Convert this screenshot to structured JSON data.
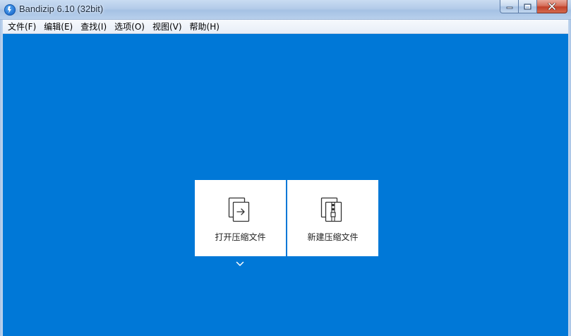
{
  "window": {
    "title": "Bandizip 6.10 (32bit)",
    "icon": "bandizip-app-icon",
    "controls": {
      "minimize_icon": "minimize-icon",
      "maximize_icon": "maximize-icon",
      "close_icon": "close-icon"
    }
  },
  "menubar": {
    "items": [
      {
        "label": "文件(F)"
      },
      {
        "label": "编辑(E)"
      },
      {
        "label": "查找(I)"
      },
      {
        "label": "选项(O)"
      },
      {
        "label": "视图(V)"
      },
      {
        "label": "帮助(H)"
      }
    ]
  },
  "main": {
    "background_color": "#0078d7",
    "cards": [
      {
        "label": "打开压缩文件",
        "icon": "open-archive-icon"
      },
      {
        "label": "新建压缩文件",
        "icon": "new-archive-icon"
      }
    ],
    "open_dropdown_icon": "chevron-down-icon"
  }
}
